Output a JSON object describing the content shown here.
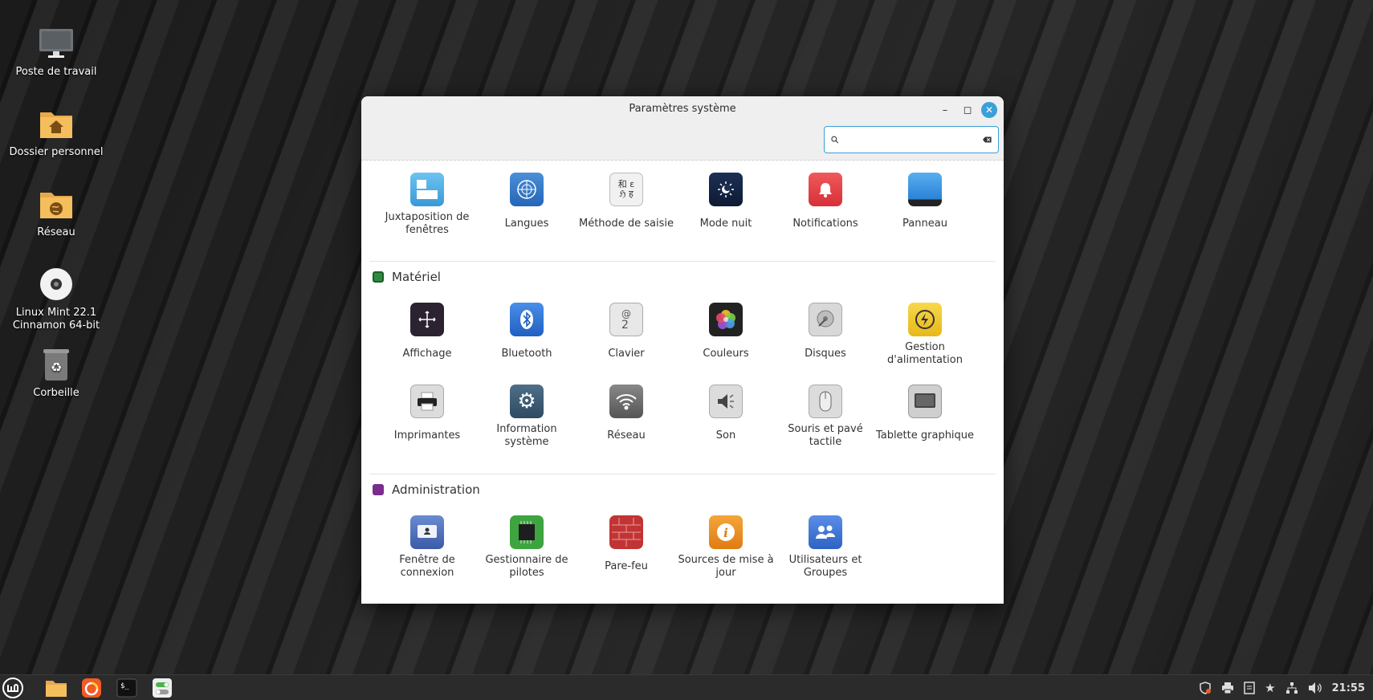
{
  "desktop": {
    "icons": [
      {
        "label": "Poste de travail"
      },
      {
        "label": "Dossier personnel"
      },
      {
        "label": "Réseau"
      },
      {
        "label": "Linux Mint 22.1 Cinnamon 64-bit"
      },
      {
        "label": "Corbeille"
      }
    ]
  },
  "window": {
    "title": "Paramètres système",
    "search_value": "",
    "sections": {
      "top_items": [
        {
          "label": "Juxtaposition de fenêtres",
          "icon": "tiling-icon"
        },
        {
          "label": "Langues",
          "icon": "languages-icon"
        },
        {
          "label": "Méthode de saisie",
          "icon": "input-method-icon"
        },
        {
          "label": "Mode nuit",
          "icon": "night-mode-icon"
        },
        {
          "label": "Notifications",
          "icon": "bell-icon"
        },
        {
          "label": "Panneau",
          "icon": "panel-icon"
        }
      ],
      "hardware": {
        "title": "Matériel",
        "items": [
          {
            "label": "Affichage",
            "icon": "display-icon"
          },
          {
            "label": "Bluetooth",
            "icon": "bluetooth-icon"
          },
          {
            "label": "Clavier",
            "icon": "keyboard-icon"
          },
          {
            "label": "Couleurs",
            "icon": "colors-icon"
          },
          {
            "label": "Disques",
            "icon": "disks-icon"
          },
          {
            "label": "Gestion d'alimentation",
            "icon": "power-icon"
          },
          {
            "label": "Imprimantes",
            "icon": "printer-icon"
          },
          {
            "label": "Information système",
            "icon": "gear-icon"
          },
          {
            "label": "Réseau",
            "icon": "wifi-icon"
          },
          {
            "label": "Son",
            "icon": "speaker-icon"
          },
          {
            "label": "Souris et pavé tactile",
            "icon": "mouse-icon"
          },
          {
            "label": "Tablette graphique",
            "icon": "tablet-icon"
          }
        ]
      },
      "admin": {
        "title": "Administration",
        "items": [
          {
            "label": "Fenêtre de connexion",
            "icon": "login-window-icon"
          },
          {
            "label": "Gestionnaire de pilotes",
            "icon": "chip-icon"
          },
          {
            "label": "Pare-feu",
            "icon": "firewall-icon"
          },
          {
            "label": "Sources de mise à jour",
            "icon": "info-icon"
          },
          {
            "label": "Utilisateurs et Groupes",
            "icon": "users-icon"
          }
        ]
      }
    }
  },
  "taskbar": {
    "clock": "21:55"
  },
  "colors": {
    "accent": "#3ba0d9",
    "hardware_section": "#4caf50",
    "admin_section": "#7b2d8b"
  }
}
